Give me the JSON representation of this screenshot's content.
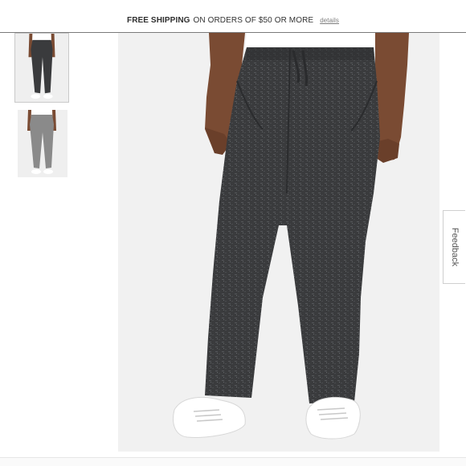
{
  "banner": {
    "bold_text": "FREE SHIPPING",
    "text": "ON ORDERS OF $50 OR MORE",
    "details_label": "details"
  },
  "gallery": {
    "thumbnails": [
      {
        "color": "dark charcoal",
        "selected": true
      },
      {
        "color": "heather gray",
        "selected": false
      }
    ]
  },
  "feedback": {
    "label": "Feedback"
  },
  "colors": {
    "pants_main": "#3a3b3d",
    "pants_thumb_2": "#8a8a8a",
    "skin": "#7a4b33",
    "shirt": "#ffffff",
    "image_bg": "#f1f1f1"
  }
}
